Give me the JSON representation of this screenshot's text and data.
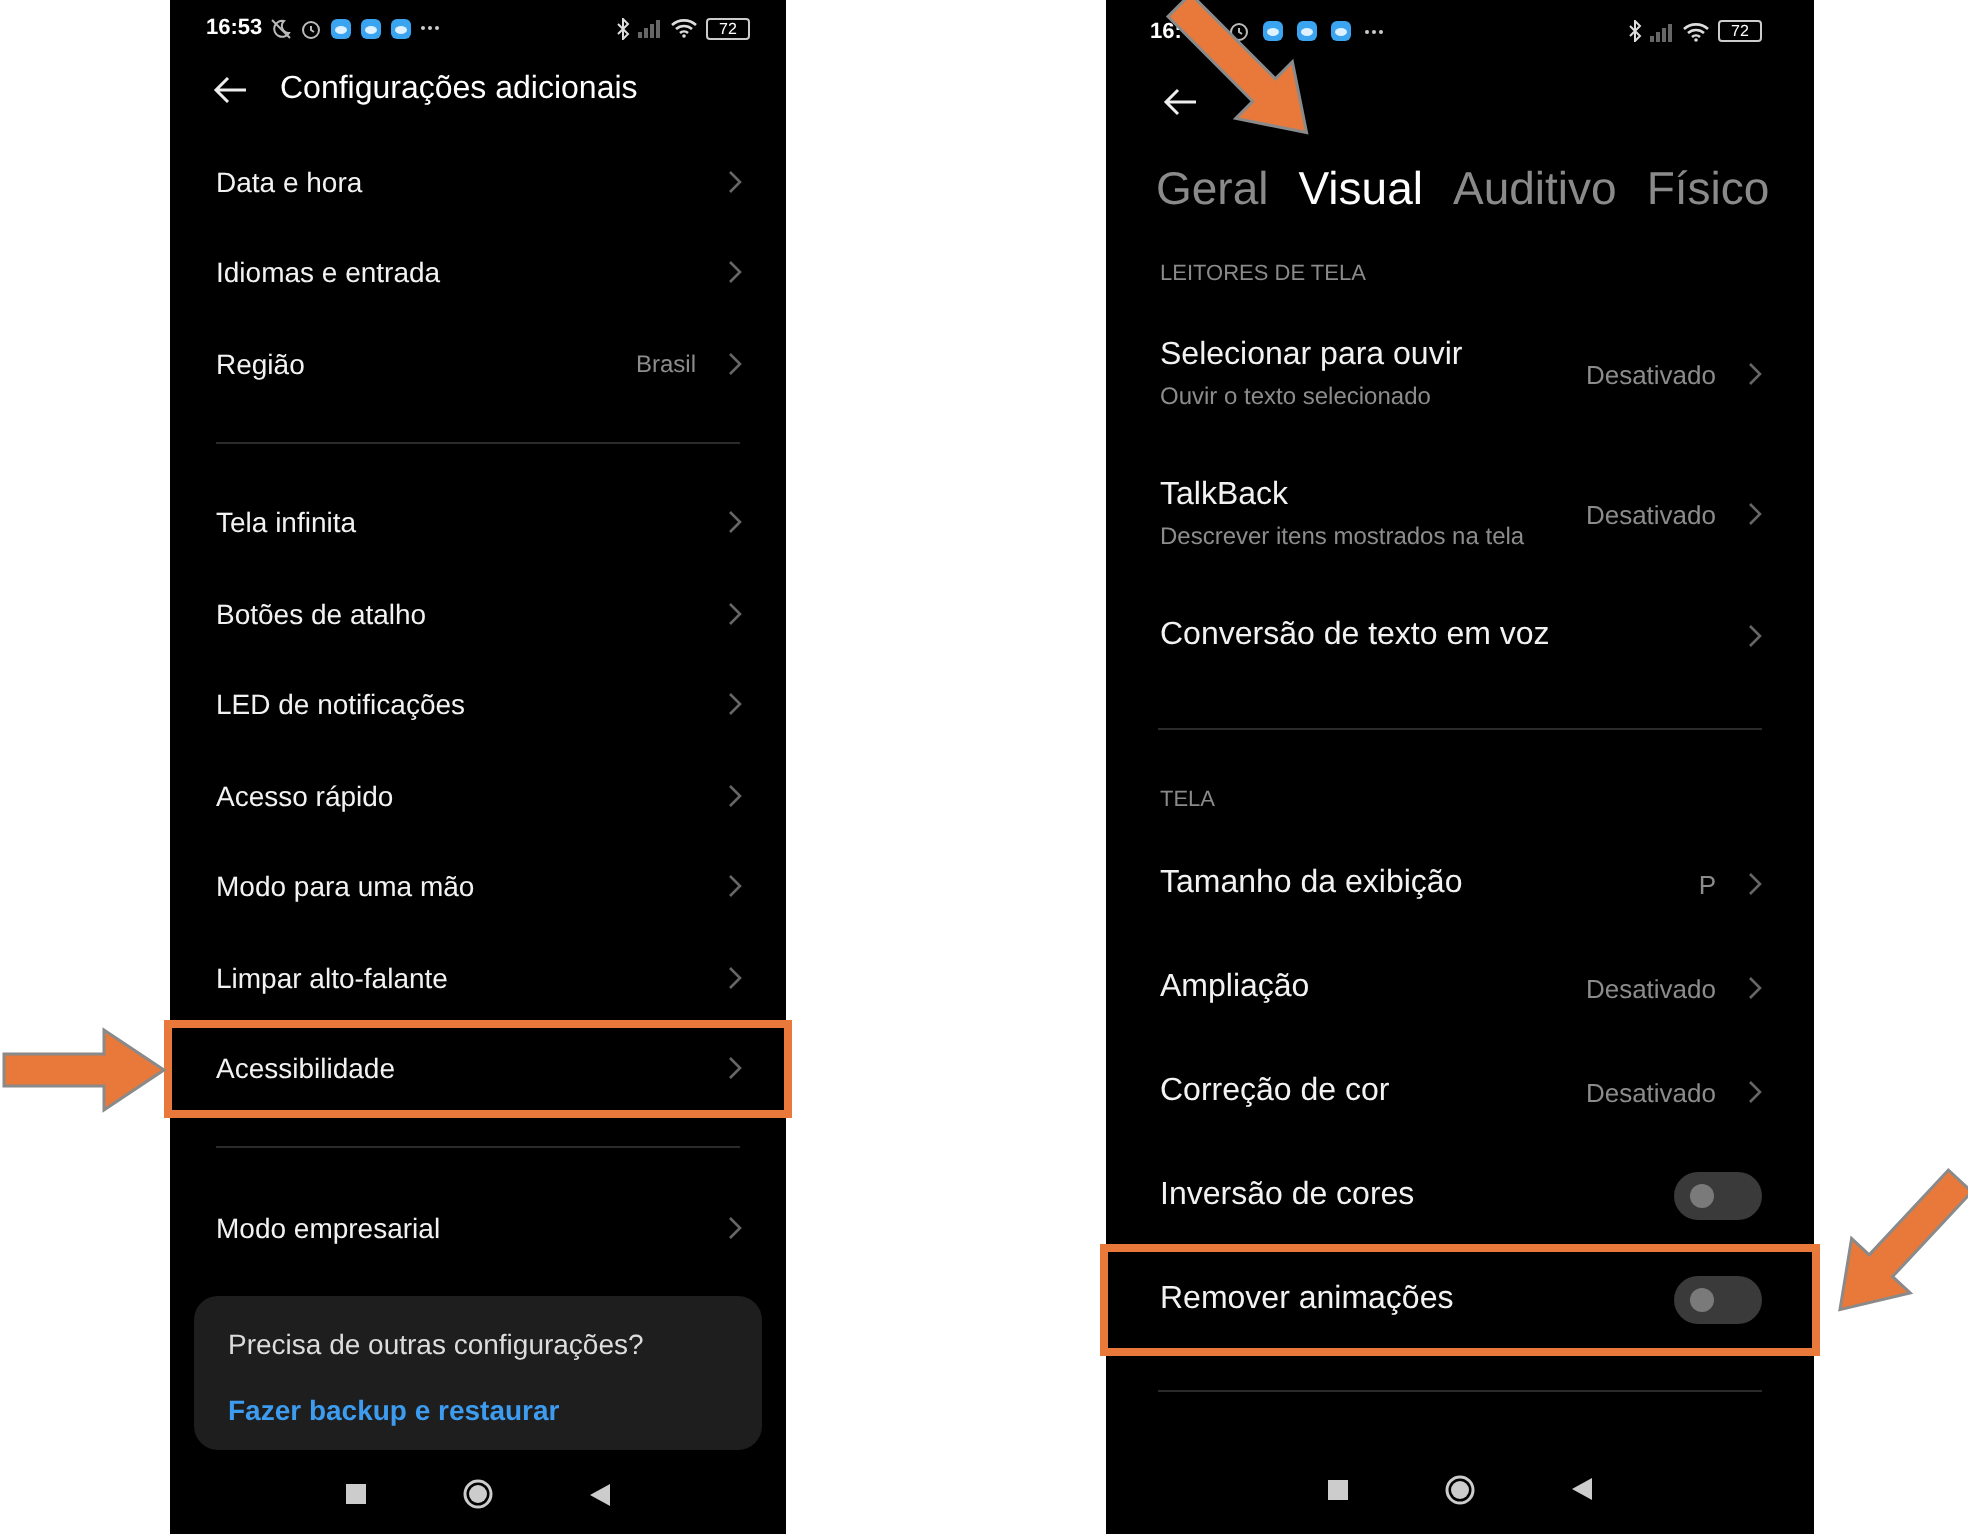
{
  "screens": [
    {
      "kind": "list",
      "status_bar": {
        "time": "16:53",
        "battery": "72"
      },
      "title": "Configurações adicionais",
      "groups": [
        {
          "items": [
            {
              "kind": "link",
              "label": "Data e hora"
            },
            {
              "kind": "link",
              "label": "Idiomas e entrada"
            },
            {
              "kind": "link",
              "label": "Região",
              "value": "Brasil"
            }
          ]
        },
        {
          "items": [
            {
              "kind": "link",
              "label": "Tela infinita"
            },
            {
              "kind": "link",
              "label": "Botões de atalho"
            },
            {
              "kind": "link",
              "label": "LED de notificações"
            },
            {
              "kind": "link",
              "label": "Acesso rápido"
            },
            {
              "kind": "link",
              "label": "Modo para uma mão"
            },
            {
              "kind": "link",
              "label": "Limpar alto-falante"
            },
            {
              "kind": "link",
              "label": "Acessibilidade",
              "highlighted": true
            }
          ]
        },
        {
          "items": [
            {
              "kind": "link",
              "label": "Modo empresarial"
            }
          ]
        }
      ],
      "card": {
        "text": "Precisa de outras configurações?",
        "link": "Fazer backup e restaurar"
      }
    },
    {
      "kind": "tabs",
      "status_bar": {
        "time": "16:",
        "battery": "72"
      },
      "tabs": [
        {
          "label": "Geral",
          "selected": false
        },
        {
          "label": "Visual",
          "selected": true,
          "pointed_at": true
        },
        {
          "label": "Auditivo",
          "selected": false
        },
        {
          "label": "Físico",
          "selected": false
        }
      ],
      "sections": [
        {
          "header": "LEITORES DE TELA",
          "items": [
            {
              "kind": "link",
              "label": "Selecionar para ouvir",
              "sub": "Ouvir o texto selecionado",
              "value": "Desativado"
            },
            {
              "kind": "link",
              "label": "TalkBack",
              "sub": "Descrever itens mostrados na tela",
              "value": "Desativado"
            },
            {
              "kind": "link",
              "label": "Conversão de texto em voz"
            }
          ]
        },
        {
          "header": "TELA",
          "items": [
            {
              "kind": "link",
              "label": "Tamanho da exibição",
              "value": "P"
            },
            {
              "kind": "link",
              "label": "Ampliação",
              "value": "Desativado"
            },
            {
              "kind": "link",
              "label": "Correção de cor",
              "value": "Desativado"
            },
            {
              "kind": "toggle",
              "label": "Inversão de cores",
              "on": false
            },
            {
              "kind": "toggle",
              "label": "Remover animações",
              "on": false,
              "highlighted": true
            }
          ]
        }
      ]
    }
  ]
}
